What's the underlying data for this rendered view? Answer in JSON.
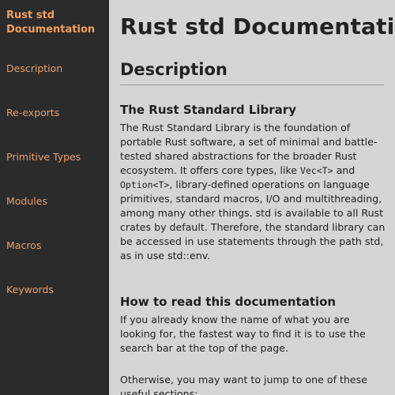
{
  "sidebar": {
    "title": "Rust std Documentation",
    "items": [
      {
        "label": "Description"
      },
      {
        "label": "Re-exports"
      },
      {
        "label": "Primitive Types"
      },
      {
        "label": "Modules"
      },
      {
        "label": "Macros"
      },
      {
        "label": "Keywords"
      }
    ]
  },
  "main": {
    "title": "Rust std Documentation",
    "section_heading": "Description",
    "library": {
      "heading": "The Rust Standard Library",
      "text_1": "The Rust Standard Library is the foundation of portable Rust software, a set of minimal and battle-tested shared abstractions for the broader Rust ecosystem. It offers core types, like ",
      "code_1": "Vec<T>",
      "text_2": " and ",
      "code_2": "Option<T>",
      "text_3": ", library-defined operations on language primitives, standard macros, I/O and multithreading, among many other things. std is available to all Rust crates by default. Therefore, the standard library can be accessed in use statements through the path std, as in use std::env."
    },
    "howto": {
      "heading": "How to read this documentation",
      "text": "If you already know the name of what you are looking for, the fastest way to find it is to use the search bar at the top of the page."
    },
    "otherwise_text": "Otherwise, you may want to jump to one of these useful sections:"
  },
  "colors": {
    "sidebar_bg": "#2b2b2b",
    "sidebar_accent": "#e6a070",
    "main_bg": "#d5d5d5"
  }
}
